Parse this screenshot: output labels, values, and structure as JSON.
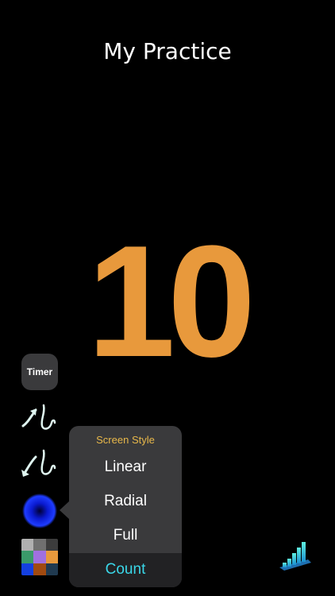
{
  "header": {
    "title": "My Practice"
  },
  "counter": {
    "value": "10",
    "color": "#e8993c"
  },
  "toolbar": {
    "timer_label": "Timer",
    "count_up_icon": "arrow-up-wave-icon",
    "count_down_icon": "arrow-down-wave-icon",
    "style_icon": "radial-blue-dot-icon",
    "palette_icon": "color-palette-grid-icon",
    "palette_colors": [
      "#b0b0b0",
      "#707070",
      "#3c3c3c",
      "#3a9a6a",
      "#a070e0",
      "#e8993c",
      "#1440e0",
      "#a04a10",
      "#203a50"
    ]
  },
  "popover": {
    "header": "Screen Style",
    "items": [
      {
        "label": "Linear"
      },
      {
        "label": "Radial"
      },
      {
        "label": "Full"
      },
      {
        "label": "Count"
      }
    ],
    "selected": "Count",
    "header_color": "#e8b84a",
    "selected_color": "#3ad7e8"
  },
  "stats": {
    "icon": "bar-chart-stairs-icon"
  }
}
